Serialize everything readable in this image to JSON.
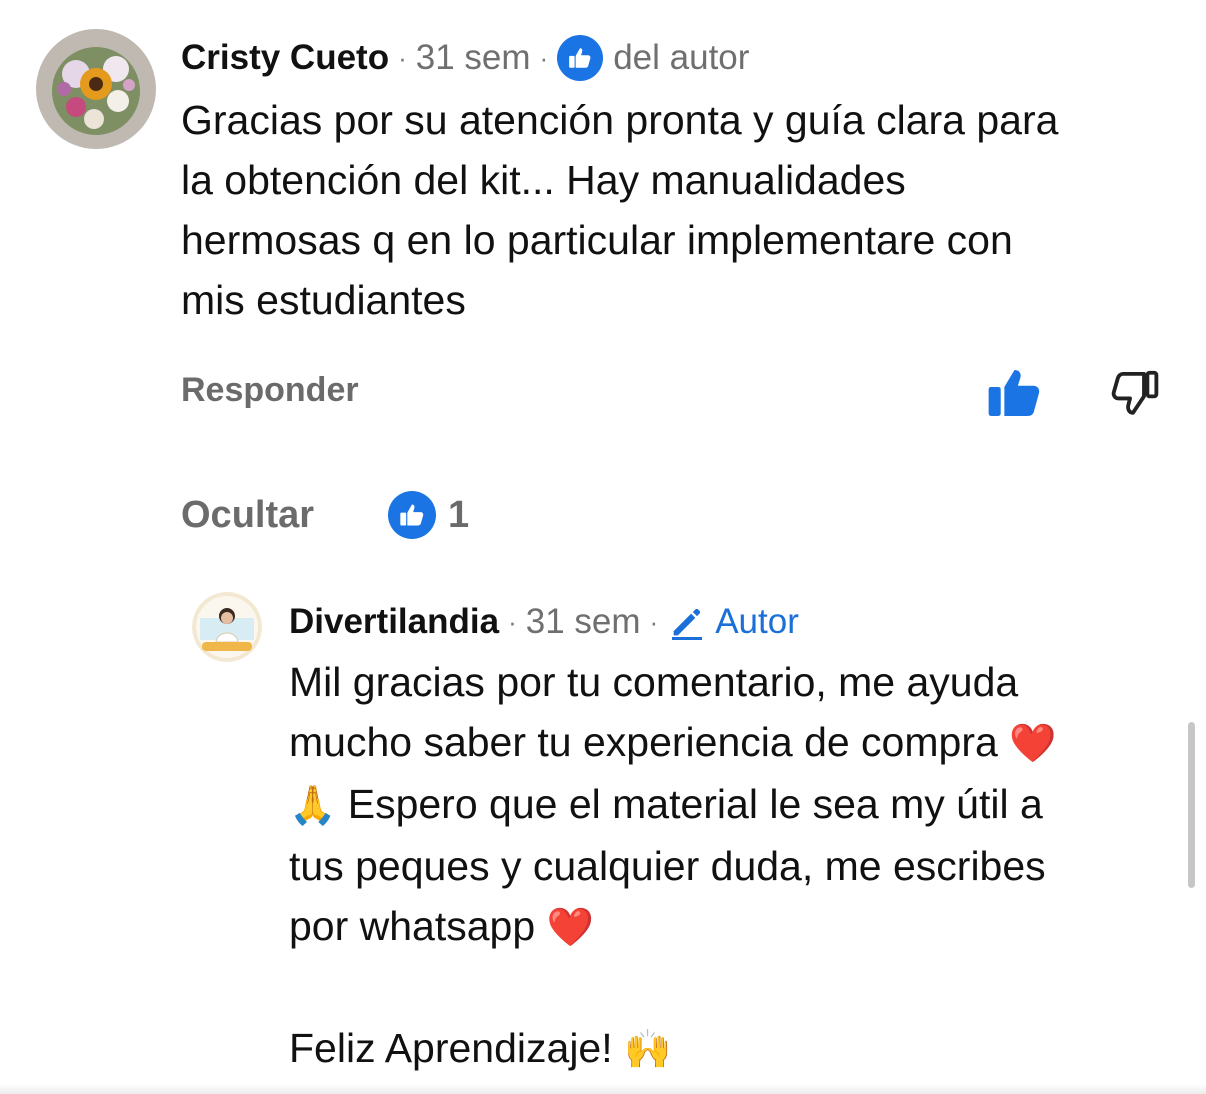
{
  "comment": {
    "author": "Cristy Cueto",
    "time": "31 sem",
    "separator": "·",
    "favorite_label": "del autor",
    "lines": [
      "Gracias por su atención pronta y guía clara para",
      "la obtención del kit... Hay manualidades",
      "hermosas q en lo particular implementare con",
      "mis estudiantes"
    ],
    "reply_label": "Responder"
  },
  "replies_bar": {
    "hide_label": "Ocultar",
    "reply_count": "1"
  },
  "reply": {
    "author": "Divertilandia",
    "time": "31 sem",
    "separator": "·",
    "author_badge": "Autor",
    "line1": "Mil gracias por tu comentario, me ayuda",
    "line2_text": "mucho saber tu experiencia de compra ",
    "line2_emoji": "❤️",
    "line3_emoji": "🙏",
    "line3_text": "  Espero que el material le sea my útil a",
    "line4": "tus peques y cualquier duda, me escribes",
    "line5_text": "por whatsapp ",
    "line5_emoji": "❤️",
    "line7_text": "Feliz Aprendizaje! ",
    "line7_emoji": "🙌"
  },
  "colors": {
    "accent_blue": "#1b74e4",
    "muted_text": "#6b6b6b",
    "body_text": "#111111"
  },
  "icons": {
    "like": "thumbs-up-icon",
    "dislike": "thumbs-down-icon",
    "edit": "pencil-icon"
  }
}
